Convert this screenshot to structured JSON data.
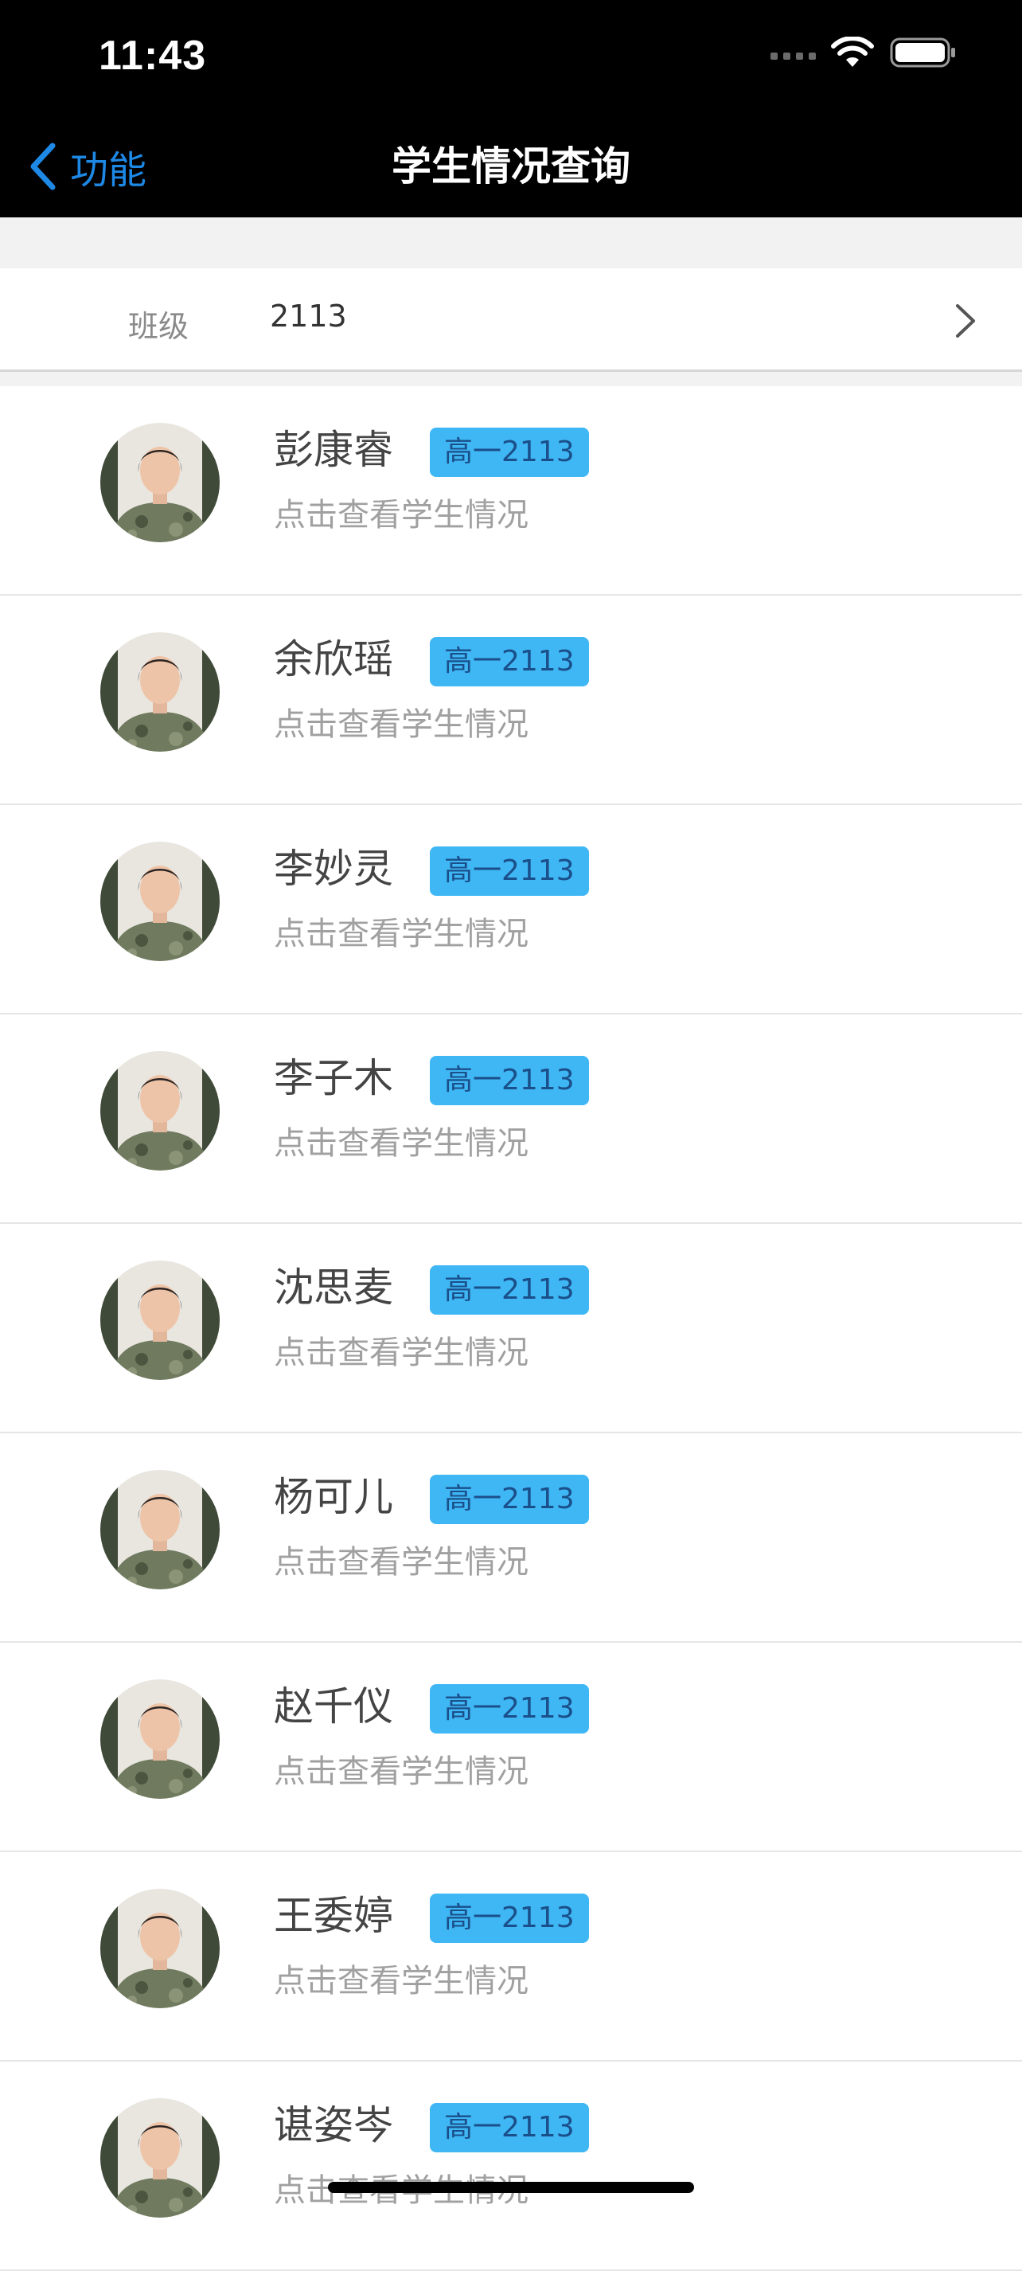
{
  "status_bar": {
    "time": "11:43"
  },
  "nav": {
    "back_label": "功能",
    "title": "学生情况查询"
  },
  "filter": {
    "label": "班级",
    "value": "2113"
  },
  "colors": {
    "accent": "#1e88e5",
    "badge": "#3fb7f4"
  },
  "students": [
    {
      "name": "彭康睿",
      "class": "高一2113",
      "hint": "点击查看学生情况"
    },
    {
      "name": "余欣瑶",
      "class": "高一2113",
      "hint": "点击查看学生情况"
    },
    {
      "name": "李妙灵",
      "class": "高一2113",
      "hint": "点击查看学生情况"
    },
    {
      "name": "李子木",
      "class": "高一2113",
      "hint": "点击查看学生情况"
    },
    {
      "name": "沈思麦",
      "class": "高一2113",
      "hint": "点击查看学生情况"
    },
    {
      "name": "杨可儿",
      "class": "高一2113",
      "hint": "点击查看学生情况"
    },
    {
      "name": "赵千仪",
      "class": "高一2113",
      "hint": "点击查看学生情况"
    },
    {
      "name": "王委婷",
      "class": "高一2113",
      "hint": "点击查看学生情况"
    },
    {
      "name": "谌姿岑",
      "class": "高一2113",
      "hint": "点击查看学生情况"
    }
  ]
}
